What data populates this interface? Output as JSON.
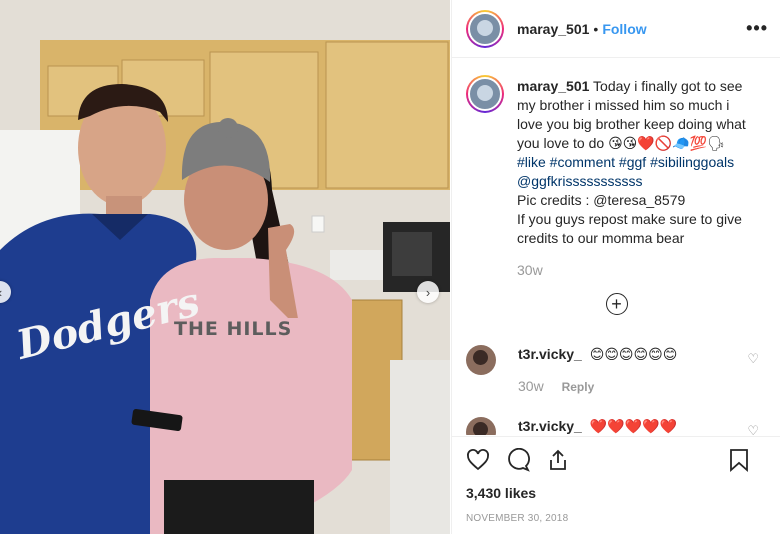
{
  "post": {
    "username": "maray_501",
    "separator": "•",
    "follow_label": "Follow",
    "more_label": "•••",
    "caption_text": "Today i finally got to see my brother i missed him so much i love you big brother keep doing what you love to do",
    "caption_emojis": "😘😘❤️🚫🧢💯🗣",
    "hashtags": "#like #comment #ggf #sibilinggoals",
    "mention": "@ggfkrisssssssssss",
    "credits": "Pic credits : @teresa_8579",
    "repost_note": "If you guys repost make sure to give credits to our momma bear",
    "time_ago": "30w",
    "load_more": "+"
  },
  "comments": [
    {
      "username": "t3r.vicky_",
      "text": "😊😊😊😊😊😊",
      "time": "30w",
      "reply_label": "Reply"
    },
    {
      "username": "t3r.vicky_",
      "text": "❤️❤️❤️❤️❤️",
      "time": "",
      "reply_label": ""
    }
  ],
  "actions": {
    "likes": "3,430 likes",
    "date": "NOVEMBER 30, 2018"
  },
  "photo": {
    "shirt_text": "Dodgers",
    "hoodie_text": "THE HILLS"
  },
  "colors": {
    "follow": "#3897f0",
    "hashtag": "#003569",
    "muted": "#999999",
    "shirt": "#1e3d8f",
    "hoodie": "#eab9c2"
  }
}
